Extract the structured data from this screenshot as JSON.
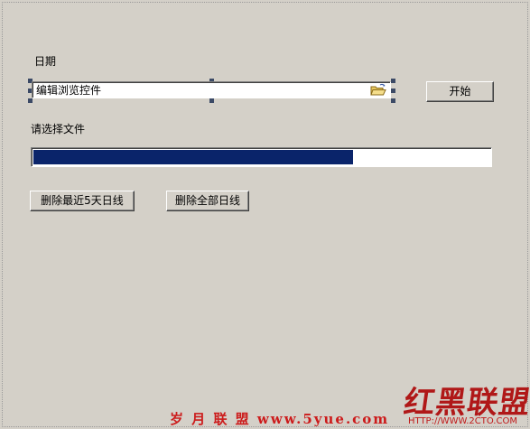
{
  "form": {
    "date_label": "日期",
    "browse_value": "编辑浏览控件",
    "start_button": "开始",
    "select_file_label": "请选择文件",
    "progress_fraction": 0.7,
    "delete_recent_button": "删除最近5天日线",
    "delete_all_button": "删除全部日线"
  },
  "icons": {
    "folder": "folder-open-icon"
  },
  "colors": {
    "progress_fill": "#0a246a",
    "background": "#d4d0c8",
    "watermark": "#cc1b1b"
  },
  "watermarks": {
    "left": "岁 月 联 盟  www.5yue.com",
    "right": "红黑联盟",
    "url": "HTTP://WWW.2CTO.COM"
  }
}
